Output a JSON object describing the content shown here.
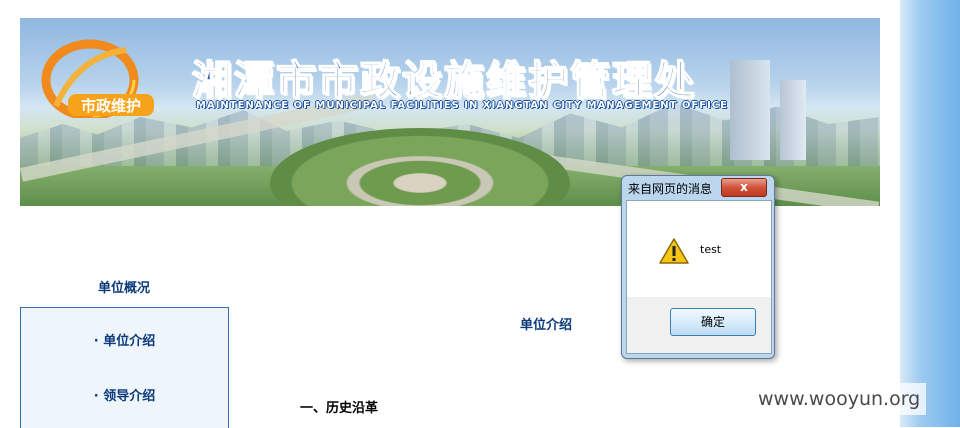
{
  "banner": {
    "logo_text": "市政维护",
    "title": "湘潭市市政设施维护管理处",
    "subtitle": "MAINTENANCE OF MUNICIPAL FACILITIES IN XIANGTAN CITY MANAGEMENT OFFICE"
  },
  "sidebar": {
    "header": "单位概况",
    "items": [
      {
        "label": "· 单位介绍"
      },
      {
        "label": "· 领导介绍"
      }
    ]
  },
  "main": {
    "heading": "单位介绍",
    "section": "一、历史沿革"
  },
  "dialog": {
    "title": "来自网页的消息",
    "close_symbol": "x",
    "message": "test",
    "ok_label": "确定",
    "icon": "warning-icon"
  },
  "watermark": "www.wooyun.org",
  "colors": {
    "nav_text": "#0d3b7a",
    "panel_bg": "#eef5fb",
    "dialog_frame": "#bcd6ee",
    "close_red": "#c03a20"
  }
}
